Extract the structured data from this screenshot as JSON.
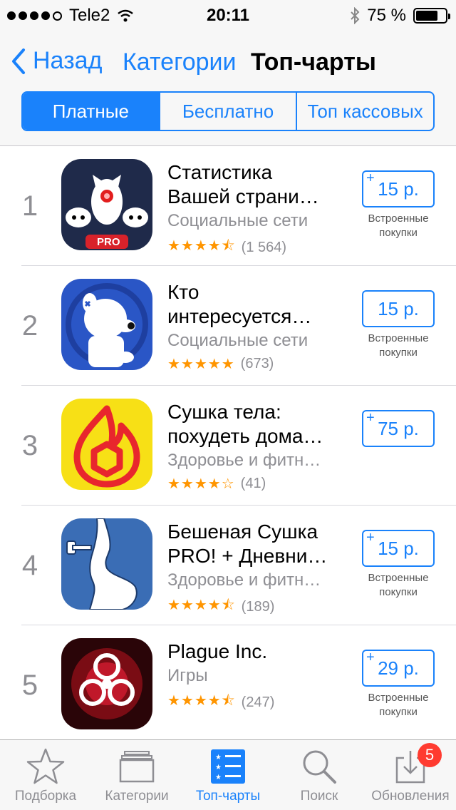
{
  "status": {
    "carrier": "Tele2",
    "time": "20:11",
    "battery": "75 %",
    "battery_level": 0.75
  },
  "nav": {
    "back": "Назад",
    "category": "Категории",
    "title": "Топ-чарты"
  },
  "segments": [
    "Платные",
    "Бесплатно",
    "Топ кассовых"
  ],
  "apps": [
    {
      "rank": "1",
      "name": "Статистика Вашей страни...",
      "line1": "Статистика",
      "line2": "Вашей страни…",
      "category": "Социальные сети",
      "stars": "★★★★⯪",
      "count": "(1 564)",
      "price": "15 р.",
      "plus": "+",
      "iap1": "Встроенные",
      "iap2": "покупки",
      "badge": "PRO"
    },
    {
      "rank": "2",
      "line1": "Кто",
      "line2": "интересуется…",
      "category": "Социальные сети",
      "stars": "★★★★★",
      "count": "(673)",
      "price": "15 р.",
      "plus": "",
      "iap1": "Встроенные",
      "iap2": "покупки"
    },
    {
      "rank": "3",
      "line1": "Сушка тела:",
      "line2": "похудеть дома…",
      "category": "Здоровье и фитн…",
      "stars": "★★★★☆",
      "count": "(41)",
      "price": "75 р.",
      "plus": "+",
      "iap1": "",
      "iap2": ""
    },
    {
      "rank": "4",
      "line1": "Бешеная  Сушка",
      "line2": "PRO! + Дневни…",
      "category": "Здоровье и фитн…",
      "stars": "★★★★⯪",
      "count": "(189)",
      "price": "15 р.",
      "plus": "+",
      "iap1": "Встроенные",
      "iap2": "покупки"
    },
    {
      "rank": "5",
      "line1": "Plague Inc.",
      "line2": "",
      "category": "Игры",
      "stars": "★★★★⯪",
      "count": "(247)",
      "price": "29 р.",
      "plus": "+",
      "iap1": "Встроенные",
      "iap2": "покупки"
    }
  ],
  "tabs": [
    "Подборка",
    "Категории",
    "Топ-чарты",
    "Поиск",
    "Обновления"
  ],
  "updates_badge": "5",
  "colors": {
    "accent": "#1a82fb",
    "star": "#ff9500",
    "badge": "#ff3b30"
  }
}
